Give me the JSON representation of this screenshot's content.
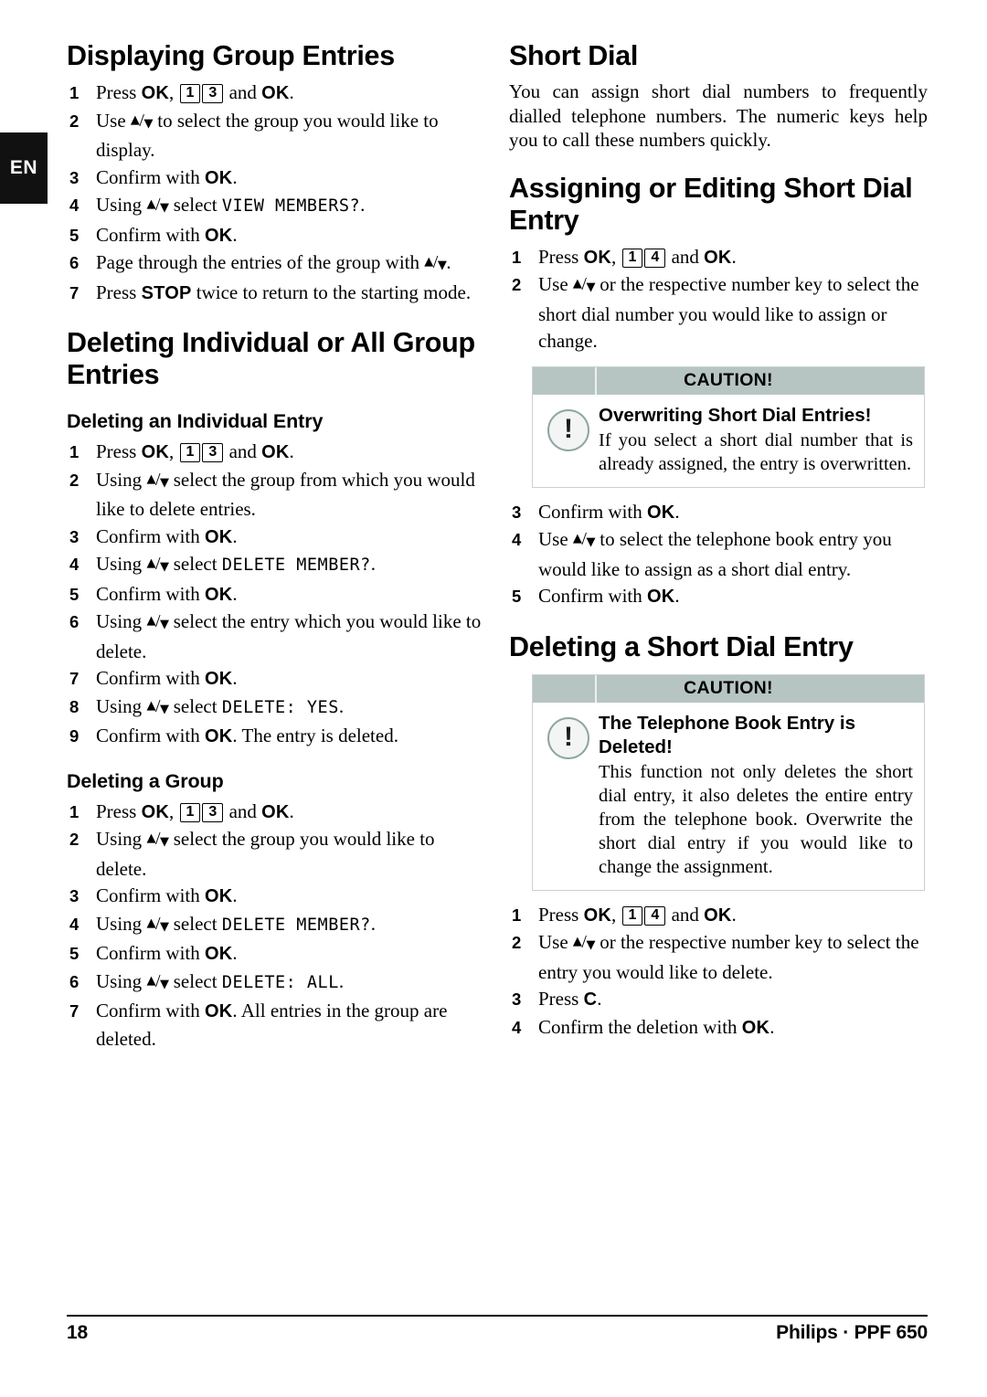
{
  "language_tab": "EN",
  "footer": {
    "page_number": "18",
    "product": "Philips · PPF 650"
  },
  "left_column": {
    "section1": {
      "heading": "Displaying Group Entries",
      "steps": [
        {
          "num": "1",
          "parts": [
            {
              "t": "text",
              "v": "Press "
            },
            {
              "t": "kb",
              "v": "OK"
            },
            {
              "t": "text",
              "v": ", "
            },
            {
              "t": "keybox",
              "v": "1"
            },
            {
              "t": "keybox",
              "v": "3"
            },
            {
              "t": "text",
              "v": " and "
            },
            {
              "t": "kb",
              "v": "OK"
            },
            {
              "t": "text",
              "v": "."
            }
          ]
        },
        {
          "num": "2",
          "parts": [
            {
              "t": "text",
              "v": "Use "
            },
            {
              "t": "arrows",
              "v": "▲/▼"
            },
            {
              "t": "text",
              "v": " to select the group you would like to display."
            }
          ]
        },
        {
          "num": "3",
          "parts": [
            {
              "t": "text",
              "v": "Confirm with "
            },
            {
              "t": "kb",
              "v": "OK"
            },
            {
              "t": "text",
              "v": "."
            }
          ]
        },
        {
          "num": "4",
          "parts": [
            {
              "t": "text",
              "v": "Using "
            },
            {
              "t": "arrows",
              "v": "▲/▼"
            },
            {
              "t": "text",
              "v": " select "
            },
            {
              "t": "lcd",
              "v": "VIEW MEMBERS?"
            },
            {
              "t": "text",
              "v": "."
            }
          ]
        },
        {
          "num": "5",
          "parts": [
            {
              "t": "text",
              "v": "Confirm with "
            },
            {
              "t": "kb",
              "v": "OK"
            },
            {
              "t": "text",
              "v": "."
            }
          ]
        },
        {
          "num": "6",
          "parts": [
            {
              "t": "text",
              "v": "Page through the entries of the group with "
            },
            {
              "t": "arrows",
              "v": "▲/▼"
            },
            {
              "t": "text",
              "v": "."
            }
          ]
        },
        {
          "num": "7",
          "parts": [
            {
              "t": "text",
              "v": "Press "
            },
            {
              "t": "kb",
              "v": "STOP"
            },
            {
              "t": "text",
              "v": " twice to return to the starting mode."
            }
          ]
        }
      ]
    },
    "section2": {
      "heading": "Deleting Individual or All Group Entries",
      "sub1": {
        "heading": "Deleting an Individual Entry",
        "steps": [
          {
            "num": "1",
            "parts": [
              {
                "t": "text",
                "v": "Press "
              },
              {
                "t": "kb",
                "v": "OK"
              },
              {
                "t": "text",
                "v": ", "
              },
              {
                "t": "keybox",
                "v": "1"
              },
              {
                "t": "keybox",
                "v": "3"
              },
              {
                "t": "text",
                "v": " and "
              },
              {
                "t": "kb",
                "v": "OK"
              },
              {
                "t": "text",
                "v": "."
              }
            ]
          },
          {
            "num": "2",
            "justify": true,
            "parts": [
              {
                "t": "text",
                "v": "Using "
              },
              {
                "t": "arrows",
                "v": "▲/▼"
              },
              {
                "t": "text",
                "v": " select the group from which you would like to delete entries."
              }
            ]
          },
          {
            "num": "3",
            "parts": [
              {
                "t": "text",
                "v": "Confirm with "
              },
              {
                "t": "kb",
                "v": "OK"
              },
              {
                "t": "text",
                "v": "."
              }
            ]
          },
          {
            "num": "4",
            "parts": [
              {
                "t": "text",
                "v": "Using "
              },
              {
                "t": "arrows",
                "v": "▲/▼"
              },
              {
                "t": "text",
                "v": " select "
              },
              {
                "t": "lcd",
                "v": "DELETE MEMBER?"
              },
              {
                "t": "text",
                "v": "."
              }
            ]
          },
          {
            "num": "5",
            "parts": [
              {
                "t": "text",
                "v": "Confirm with "
              },
              {
                "t": "kb",
                "v": "OK"
              },
              {
                "t": "text",
                "v": "."
              }
            ]
          },
          {
            "num": "6",
            "justify": true,
            "parts": [
              {
                "t": "text",
                "v": "Using "
              },
              {
                "t": "arrows",
                "v": "▲/▼"
              },
              {
                "t": "text",
                "v": " select the entry which you would like to delete."
              }
            ]
          },
          {
            "num": "7",
            "parts": [
              {
                "t": "text",
                "v": "Confirm with "
              },
              {
                "t": "kb",
                "v": "OK"
              },
              {
                "t": "text",
                "v": "."
              }
            ]
          },
          {
            "num": "8",
            "parts": [
              {
                "t": "text",
                "v": "Using "
              },
              {
                "t": "arrows",
                "v": "▲/▼"
              },
              {
                "t": "text",
                "v": " select "
              },
              {
                "t": "lcd",
                "v": "DELETE: YES"
              },
              {
                "t": "text",
                "v": "."
              }
            ]
          },
          {
            "num": "9",
            "parts": [
              {
                "t": "text",
                "v": "Confirm with "
              },
              {
                "t": "kb",
                "v": "OK"
              },
              {
                "t": "text",
                "v": ". The entry is deleted."
              }
            ]
          }
        ]
      },
      "sub2": {
        "heading": "Deleting a Group",
        "steps": [
          {
            "num": "1",
            "parts": [
              {
                "t": "text",
                "v": "Press "
              },
              {
                "t": "kb",
                "v": "OK"
              },
              {
                "t": "text",
                "v": ", "
              },
              {
                "t": "keybox",
                "v": "1"
              },
              {
                "t": "keybox",
                "v": "3"
              },
              {
                "t": "text",
                "v": " and "
              },
              {
                "t": "kb",
                "v": "OK"
              },
              {
                "t": "text",
                "v": "."
              }
            ]
          },
          {
            "num": "2",
            "parts": [
              {
                "t": "text",
                "v": "Using "
              },
              {
                "t": "arrows",
                "v": "▲/▼"
              },
              {
                "t": "text",
                "v": " select the group you would like to delete."
              }
            ]
          },
          {
            "num": "3",
            "parts": [
              {
                "t": "text",
                "v": "Confirm with "
              },
              {
                "t": "kb",
                "v": "OK"
              },
              {
                "t": "text",
                "v": "."
              }
            ]
          },
          {
            "num": "4",
            "parts": [
              {
                "t": "text",
                "v": "Using "
              },
              {
                "t": "arrows",
                "v": "▲/▼"
              },
              {
                "t": "text",
                "v": " select "
              },
              {
                "t": "lcd",
                "v": "DELETE MEMBER?"
              },
              {
                "t": "text",
                "v": "."
              }
            ]
          },
          {
            "num": "5",
            "parts": [
              {
                "t": "text",
                "v": "Confirm with "
              },
              {
                "t": "kb",
                "v": "OK"
              },
              {
                "t": "text",
                "v": "."
              }
            ]
          },
          {
            "num": "6",
            "parts": [
              {
                "t": "text",
                "v": "Using "
              },
              {
                "t": "arrows",
                "v": "▲/▼"
              },
              {
                "t": "text",
                "v": " select "
              },
              {
                "t": "lcd",
                "v": "DELETE: ALL"
              },
              {
                "t": "text",
                "v": "."
              }
            ]
          },
          {
            "num": "7",
            "parts": [
              {
                "t": "text",
                "v": "Confirm with "
              },
              {
                "t": "kb",
                "v": "OK"
              },
              {
                "t": "text",
                "v": ". All entries in the group are deleted."
              }
            ]
          }
        ]
      }
    }
  },
  "right_column": {
    "section1": {
      "heading": "Short Dial",
      "intro": "You can assign short dial numbers to frequently dialled telephone numbers. The numeric keys help you to call these numbers quickly."
    },
    "section2": {
      "heading": "Assigning or Editing Short Dial Entry",
      "steps_before": [
        {
          "num": "1",
          "parts": [
            {
              "t": "text",
              "v": "Press "
            },
            {
              "t": "kb",
              "v": "OK"
            },
            {
              "t": "text",
              "v": ", "
            },
            {
              "t": "keybox",
              "v": "1"
            },
            {
              "t": "keybox",
              "v": "4"
            },
            {
              "t": "text",
              "v": " and "
            },
            {
              "t": "kb",
              "v": "OK"
            },
            {
              "t": "text",
              "v": "."
            }
          ]
        },
        {
          "num": "2",
          "justify": true,
          "parts": [
            {
              "t": "text",
              "v": "Use "
            },
            {
              "t": "arrows",
              "v": "▲/▼"
            },
            {
              "t": "text",
              "v": " or the respective number key to select the short dial number you would like to assign or change."
            }
          ]
        }
      ],
      "caution": {
        "title": "CAUTION!",
        "icon": "warning-exclamation-icon",
        "strong": "Overwriting Short Dial Entries!",
        "text": "If you select a short dial number that is already assigned, the entry is overwritten."
      },
      "steps_after": [
        {
          "num": "3",
          "parts": [
            {
              "t": "text",
              "v": "Confirm with "
            },
            {
              "t": "kb",
              "v": "OK"
            },
            {
              "t": "text",
              "v": "."
            }
          ]
        },
        {
          "num": "4",
          "justify": true,
          "parts": [
            {
              "t": "text",
              "v": "Use "
            },
            {
              "t": "arrows",
              "v": "▲/▼"
            },
            {
              "t": "text",
              "v": " to select the telephone book entry you would like to assign as a short dial entry."
            }
          ]
        },
        {
          "num": "5",
          "parts": [
            {
              "t": "text",
              "v": "Confirm with "
            },
            {
              "t": "kb",
              "v": "OK"
            },
            {
              "t": "text",
              "v": "."
            }
          ]
        }
      ]
    },
    "section3": {
      "heading": "Deleting a Short Dial Entry",
      "caution": {
        "title": "CAUTION!",
        "icon": "warning-exclamation-icon",
        "strong": "The Telephone Book Entry is Deleted!",
        "text": "This function not only deletes the short dial entry, it also deletes the entire entry from the telephone book. Overwrite the short dial entry if you would like to change the assignment."
      },
      "steps": [
        {
          "num": "1",
          "parts": [
            {
              "t": "text",
              "v": "Press "
            },
            {
              "t": "kb",
              "v": "OK"
            },
            {
              "t": "text",
              "v": ", "
            },
            {
              "t": "keybox",
              "v": "1"
            },
            {
              "t": "keybox",
              "v": "4"
            },
            {
              "t": "text",
              "v": " and "
            },
            {
              "t": "kb",
              "v": "OK"
            },
            {
              "t": "text",
              "v": "."
            }
          ]
        },
        {
          "num": "2",
          "justify": true,
          "parts": [
            {
              "t": "text",
              "v": "Use "
            },
            {
              "t": "arrows",
              "v": "▲/▼"
            },
            {
              "t": "text",
              "v": " or the respective number key to select the entry you would like to delete."
            }
          ]
        },
        {
          "num": "3",
          "parts": [
            {
              "t": "text",
              "v": "Press "
            },
            {
              "t": "kb",
              "v": "C"
            },
            {
              "t": "text",
              "v": "."
            }
          ]
        },
        {
          "num": "4",
          "parts": [
            {
              "t": "text",
              "v": "Confirm the deletion with "
            },
            {
              "t": "kb",
              "v": "OK"
            },
            {
              "t": "text",
              "v": "."
            }
          ]
        }
      ]
    }
  },
  "colors": {
    "caution_header_bg": "#b6c4c2",
    "caution_border": "#c9d2d0",
    "icon_ring": "#8fa5a3",
    "tab_bg": "#111111"
  }
}
